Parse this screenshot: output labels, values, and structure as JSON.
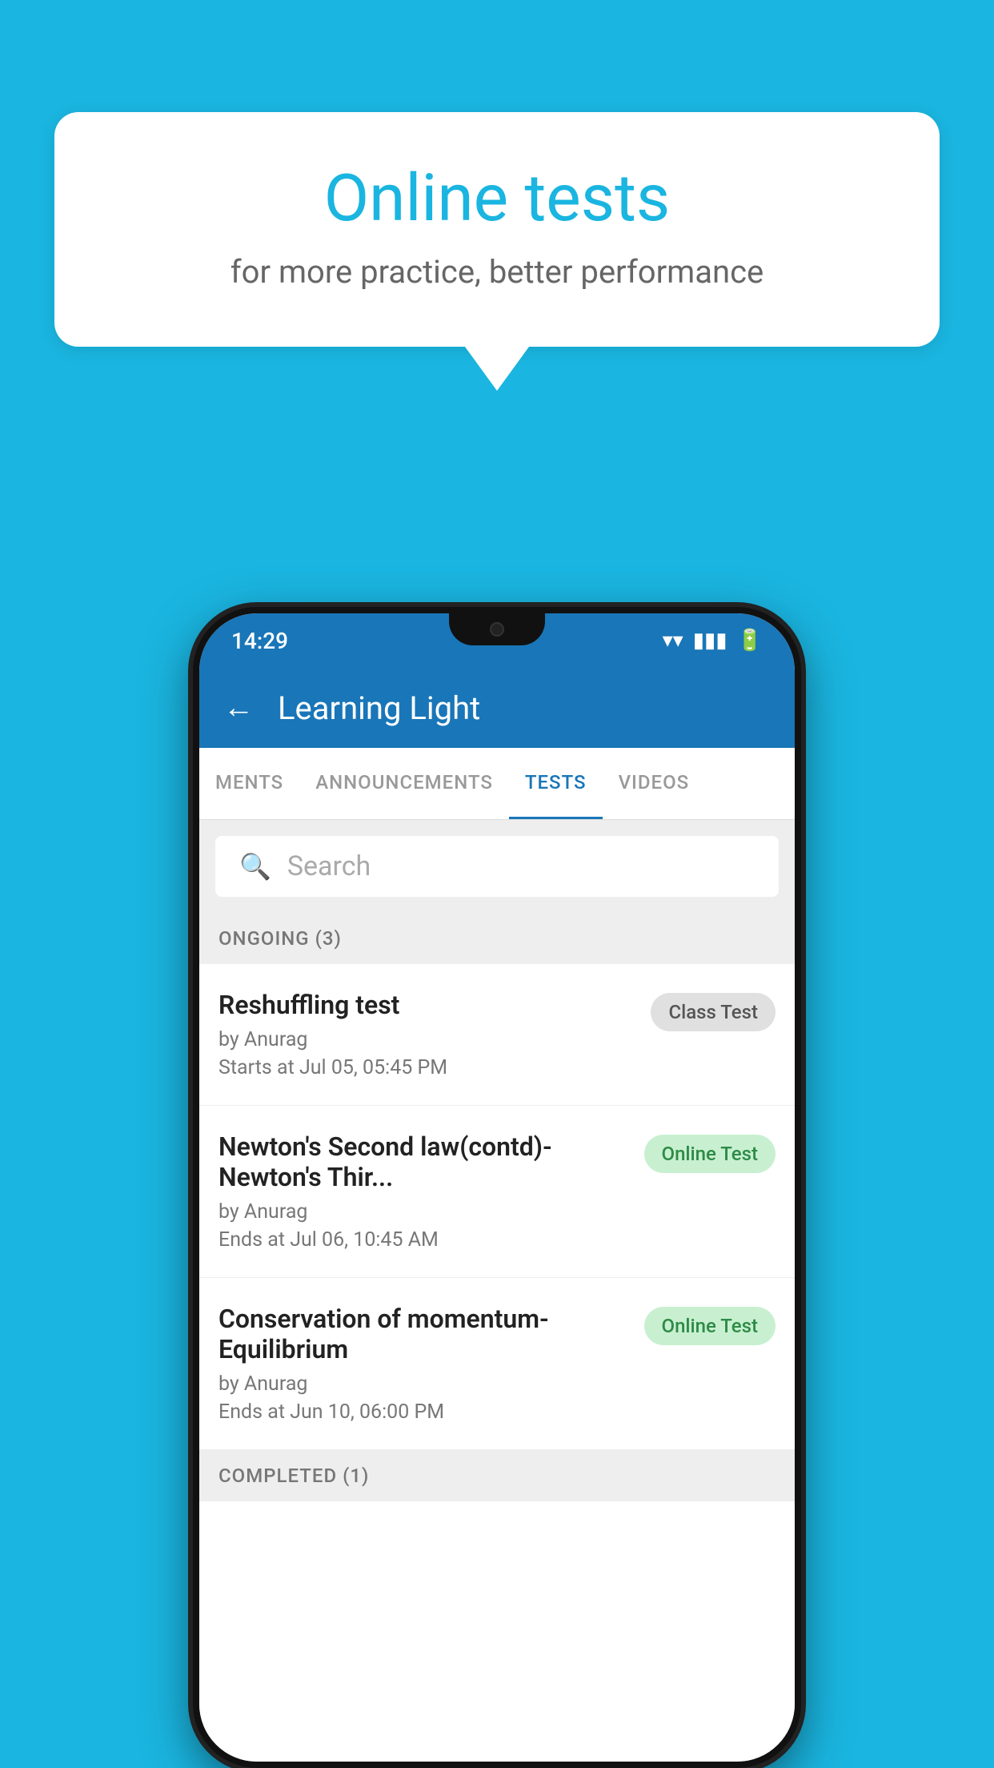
{
  "background_color": "#1ab5e0",
  "speech_bubble": {
    "title": "Online tests",
    "subtitle": "for more practice, better performance"
  },
  "status_bar": {
    "time": "14:29",
    "wifi_icon": "▼",
    "signal_icon": "▲",
    "battery_icon": "▮"
  },
  "app_bar": {
    "title": "Learning Light",
    "back_label": "←"
  },
  "tabs": [
    {
      "label": "MENTS",
      "active": false
    },
    {
      "label": "ANNOUNCEMENTS",
      "active": false
    },
    {
      "label": "TESTS",
      "active": true
    },
    {
      "label": "VIDEOS",
      "active": false
    }
  ],
  "search": {
    "placeholder": "Search"
  },
  "ongoing_section": {
    "label": "ONGOING (3)",
    "tests": [
      {
        "name": "Reshuffling test",
        "author": "by Anurag",
        "time": "Starts at  Jul 05, 05:45 PM",
        "badge": "Class Test",
        "badge_type": "class"
      },
      {
        "name": "Newton's Second law(contd)-Newton's Thir...",
        "author": "by Anurag",
        "time": "Ends at  Jul 06, 10:45 AM",
        "badge": "Online Test",
        "badge_type": "online"
      },
      {
        "name": "Conservation of momentum-Equilibrium",
        "author": "by Anurag",
        "time": "Ends at  Jun 10, 06:00 PM",
        "badge": "Online Test",
        "badge_type": "online"
      }
    ]
  },
  "completed_section": {
    "label": "COMPLETED (1)"
  }
}
